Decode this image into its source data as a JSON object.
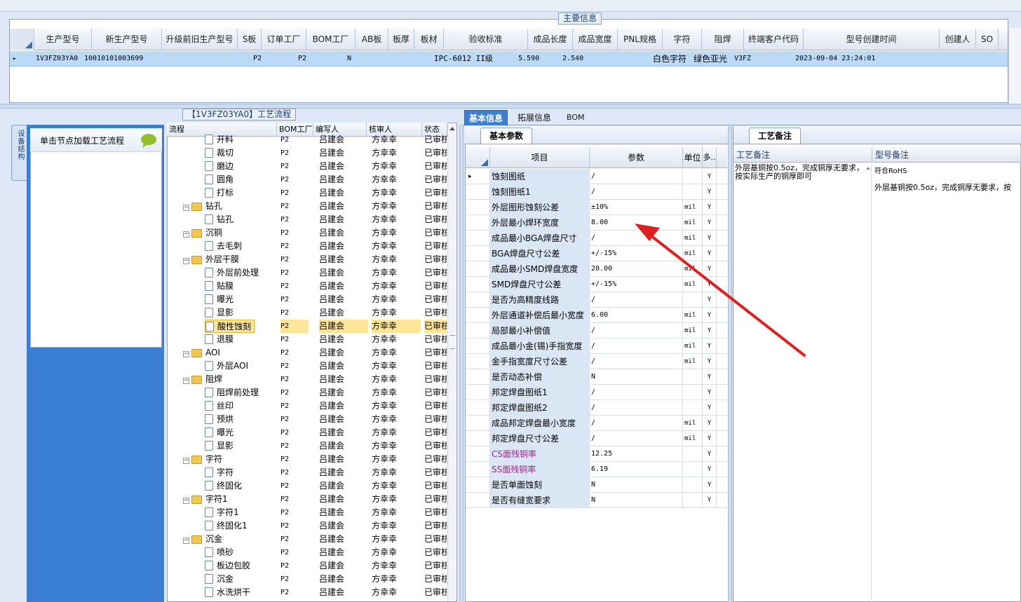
{
  "main_info": {
    "title": "主要信息",
    "columns": [
      "生产型号",
      "新生产型号",
      "升级前旧生产型号",
      "S板",
      "订单工厂",
      "BOM工厂",
      "AB板",
      "板厚",
      "板材",
      "验收标准",
      "成品长度",
      "成品宽度",
      "PNL规格",
      "字符",
      "阻焊",
      "终端客户代码",
      "型号创建时间",
      "创建人",
      "SO"
    ],
    "row": {
      "marker": "▸",
      "prod_model": "1V3FZ03YA0",
      "new_model": "10010101003699",
      "order_factory": "P2",
      "bom_factory": "P2",
      "ab_board": "N",
      "standard": "IPC-6012 II级",
      "length": "5.590",
      "width": "2.540",
      "char": "白色字符",
      "solder": "绿色亚光",
      "customer": "V3FZ",
      "created": "2023-09-04 23:24:01"
    }
  },
  "process": {
    "title": "【1V3FZ03YA0】工艺流程",
    "side_tab": "设备结构",
    "click_hint": "单击节点加载工艺流程",
    "columns": [
      "流程",
      "BOM工厂",
      "编写人",
      "核审人",
      "状态"
    ],
    "rows": [
      {
        "name": "开料",
        "level": 2,
        "bom": "P2",
        "writer": "吕建会",
        "reviewer": "方幸幸",
        "status": "已审核"
      },
      {
        "name": "裁切",
        "level": 2,
        "bom": "P2",
        "writer": "吕建会",
        "reviewer": "方幸幸",
        "status": "已审核"
      },
      {
        "name": "磨边",
        "level": 2,
        "bom": "P2",
        "writer": "吕建会",
        "reviewer": "方幸幸",
        "status": "已审核"
      },
      {
        "name": "圆角",
        "level": 2,
        "bom": "P2",
        "writer": "吕建会",
        "reviewer": "方幸幸",
        "status": "已审核"
      },
      {
        "name": "打标",
        "level": 2,
        "bom": "P2",
        "writer": "吕建会",
        "reviewer": "方幸幸",
        "status": "已审核"
      },
      {
        "name": "钻孔",
        "level": 1,
        "bom": "P2",
        "writer": "吕建会",
        "reviewer": "方幸幸",
        "status": "已审核"
      },
      {
        "name": "钻孔",
        "level": 2,
        "bom": "P2",
        "writer": "吕建会",
        "reviewer": "方幸幸",
        "status": "已审核"
      },
      {
        "name": "沉铜",
        "level": 1,
        "bom": "P2",
        "writer": "吕建会",
        "reviewer": "方幸幸",
        "status": "已审核"
      },
      {
        "name": "去毛刺",
        "level": 2,
        "bom": "P2",
        "writer": "吕建会",
        "reviewer": "方幸幸",
        "status": "已审核"
      },
      {
        "name": "外层干膜",
        "level": 1,
        "bom": "P2",
        "writer": "吕建会",
        "reviewer": "方幸幸",
        "status": "已审核"
      },
      {
        "name": "外层前处理",
        "level": 2,
        "bom": "P2",
        "writer": "吕建会",
        "reviewer": "方幸幸",
        "status": "已审核"
      },
      {
        "name": "贴膜",
        "level": 2,
        "bom": "P2",
        "writer": "吕建会",
        "reviewer": "方幸幸",
        "status": "已审核"
      },
      {
        "name": "曝光",
        "level": 2,
        "bom": "P2",
        "writer": "吕建会",
        "reviewer": "方幸幸",
        "status": "已审核"
      },
      {
        "name": "显影",
        "level": 2,
        "bom": "P2",
        "writer": "吕建会",
        "reviewer": "方幸幸",
        "status": "已审核"
      },
      {
        "name": "酸性蚀刻",
        "level": 2,
        "bom": "P2",
        "writer": "吕建会",
        "reviewer": "方幸幸",
        "status": "已审核",
        "selected": true
      },
      {
        "name": "退膜",
        "level": 2,
        "bom": "P2",
        "writer": "吕建会",
        "reviewer": "方幸幸",
        "status": "已审核"
      },
      {
        "name": "AOI",
        "level": 1,
        "bom": "P2",
        "writer": "吕建会",
        "reviewer": "方幸幸",
        "status": "已审核"
      },
      {
        "name": "外层AOI",
        "level": 2,
        "bom": "P2",
        "writer": "吕建会",
        "reviewer": "方幸幸",
        "status": "已审核"
      },
      {
        "name": "阻焊",
        "level": 1,
        "bom": "P2",
        "writer": "吕建会",
        "reviewer": "方幸幸",
        "status": "已审核"
      },
      {
        "name": "阻焊前处理",
        "level": 2,
        "bom": "P2",
        "writer": "吕建会",
        "reviewer": "方幸幸",
        "status": "已审核"
      },
      {
        "name": "丝印",
        "level": 2,
        "bom": "P2",
        "writer": "吕建会",
        "reviewer": "方幸幸",
        "status": "已审核"
      },
      {
        "name": "预烘",
        "level": 2,
        "bom": "P2",
        "writer": "吕建会",
        "reviewer": "方幸幸",
        "status": "已审核"
      },
      {
        "name": "曝光",
        "level": 2,
        "bom": "P2",
        "writer": "吕建会",
        "reviewer": "方幸幸",
        "status": "已审核"
      },
      {
        "name": "显影",
        "level": 2,
        "bom": "P2",
        "writer": "吕建会",
        "reviewer": "方幸幸",
        "status": "已审核"
      },
      {
        "name": "字符",
        "level": 1,
        "bom": "P2",
        "writer": "吕建会",
        "reviewer": "方幸幸",
        "status": "已审核"
      },
      {
        "name": "字符",
        "level": 2,
        "bom": "P2",
        "writer": "吕建会",
        "reviewer": "方幸幸",
        "status": "已审核"
      },
      {
        "name": "终固化",
        "level": 2,
        "bom": "P2",
        "writer": "吕建会",
        "reviewer": "方幸幸",
        "status": "已审核"
      },
      {
        "name": "字符1",
        "level": 1,
        "bom": "P2",
        "writer": "吕建会",
        "reviewer": "方幸幸",
        "status": "已审核"
      },
      {
        "name": "字符1",
        "level": 2,
        "bom": "P2",
        "writer": "吕建会",
        "reviewer": "方幸幸",
        "status": "已审核"
      },
      {
        "name": "终固化1",
        "level": 2,
        "bom": "P2",
        "writer": "吕建会",
        "reviewer": "方幸幸",
        "status": "已审核"
      },
      {
        "name": "沉金",
        "level": 1,
        "bom": "P2",
        "writer": "吕建会",
        "reviewer": "方幸幸",
        "status": "已审核"
      },
      {
        "name": "喷砂",
        "level": 2,
        "bom": "P2",
        "writer": "吕建会",
        "reviewer": "方幸幸",
        "status": "已审核"
      },
      {
        "name": "板边包胶",
        "level": 2,
        "bom": "P2",
        "writer": "吕建会",
        "reviewer": "方幸幸",
        "status": "已审核"
      },
      {
        "name": "沉金",
        "level": 2,
        "bom": "P2",
        "writer": "吕建会",
        "reviewer": "方幸幸",
        "status": "已审核"
      },
      {
        "name": "水洗烘干",
        "level": 2,
        "bom": "P2",
        "writer": "吕建会",
        "reviewer": "方幸幸",
        "status": "已审核"
      }
    ]
  },
  "tabs": [
    "基本信息",
    "拓展信息",
    "BOM"
  ],
  "basic": {
    "sub_tab": "基本参数",
    "columns": [
      "项目",
      "参数",
      "单位",
      "多.."
    ],
    "rows": [
      {
        "item": "蚀刻图纸",
        "value": "/",
        "unit": "",
        "flag": "Y",
        "current": true
      },
      {
        "item": "蚀刻图纸1",
        "value": "/",
        "unit": "",
        "flag": "Y"
      },
      {
        "item": "外层图形蚀刻公差",
        "value": "±10%",
        "unit": "mil",
        "flag": "Y"
      },
      {
        "item": "外层最小焊环宽度",
        "value": "8.00",
        "unit": "mil",
        "flag": "Y"
      },
      {
        "item": "成品最小BGA焊盘尺寸",
        "value": "/",
        "unit": "mil",
        "flag": "Y"
      },
      {
        "item": "BGA焊盘尺寸公差",
        "value": "+/-15%",
        "unit": "mil",
        "flag": "Y"
      },
      {
        "item": "成品最小SMD焊盘宽度",
        "value": "20.00",
        "unit": "mil",
        "flag": "Y"
      },
      {
        "item": "SMD焊盘尺寸公差",
        "value": "+/-15%",
        "unit": "mil",
        "flag": "Y"
      },
      {
        "item": "是否为高精度线路",
        "value": "/",
        "unit": "",
        "flag": "Y"
      },
      {
        "item": "外层通道补偿后最小宽度",
        "value": "6.00",
        "unit": "mil",
        "flag": "Y"
      },
      {
        "item": "局部最小补偿值",
        "value": "/",
        "unit": "mil",
        "flag": "Y"
      },
      {
        "item": "成品最小金(锡)手指宽度",
        "value": "/",
        "unit": "mil",
        "flag": "Y"
      },
      {
        "item": "金手指宽度尺寸公差",
        "value": "/",
        "unit": "mil",
        "flag": "Y"
      },
      {
        "item": "是否动态补偿",
        "value": "N",
        "unit": "",
        "flag": "Y"
      },
      {
        "item": "邦定焊盘图纸1",
        "value": "/",
        "unit": "",
        "flag": "Y"
      },
      {
        "item": "邦定焊盘图纸2",
        "value": "/",
        "unit": "",
        "flag": "Y"
      },
      {
        "item": "成品邦定焊盘最小宽度",
        "value": "/",
        "unit": "mil",
        "flag": "Y"
      },
      {
        "item": "邦定焊盘尺寸公差",
        "value": "/",
        "unit": "mil",
        "flag": "Y"
      },
      {
        "item": "CS面残铜率",
        "value": "12.25",
        "unit": "",
        "flag": "Y",
        "purple": true
      },
      {
        "item": "SS面残铜率",
        "value": "6.19",
        "unit": "",
        "flag": "Y",
        "purple": true
      },
      {
        "item": "是否单面蚀刻",
        "value": "N",
        "unit": "",
        "flag": "Y"
      },
      {
        "item": "是否有缝宽要求",
        "value": "N",
        "unit": "",
        "flag": "Y"
      }
    ]
  },
  "remarks": {
    "sub_tab": "工艺备注",
    "col1": "工艺备注",
    "col2": "型号备注",
    "process_note": "外层基铜按0.5oz，完成铜厚无要求，按实际生产的铜厚即可",
    "model_note_1": "符合RoHS",
    "model_note_2": "外层基铜按0.5oz，完成铜厚无要求，按"
  },
  "annotation": {
    "color": "#e02020"
  }
}
